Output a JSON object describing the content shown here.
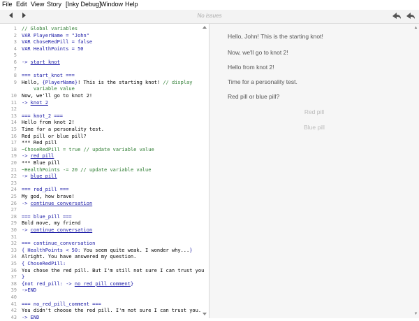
{
  "menu": [
    "File",
    "Edit",
    "View",
    "Story",
    "[Inky Debug]",
    "Window",
    "Help"
  ],
  "toolbar": {
    "back_icon": "left-triangle-icon",
    "forward_icon": "right-triangle-icon",
    "status": "No issues",
    "rewind_icon": "rewind-arrow-icon",
    "step_back_icon": "step-back-arrow-icon"
  },
  "code": [
    {
      "n": "1",
      "segs": [
        {
          "t": "// Global variables",
          "c": "cm"
        }
      ]
    },
    {
      "n": "2",
      "segs": [
        {
          "t": "VAR PlayerName = \"John\"",
          "c": "dv"
        }
      ]
    },
    {
      "n": "3",
      "segs": [
        {
          "t": "VAR ChoseRedPill = false",
          "c": "dv"
        }
      ]
    },
    {
      "n": "4",
      "segs": [
        {
          "t": "VAR HealthPoints = 50",
          "c": "dv"
        }
      ]
    },
    {
      "n": "5",
      "segs": []
    },
    {
      "n": "6",
      "segs": [
        {
          "t": "-> ",
          "c": "lg"
        },
        {
          "t": "start_knot",
          "c": "lk"
        }
      ]
    },
    {
      "n": "7",
      "segs": []
    },
    {
      "n": "8",
      "segs": [
        {
          "t": "=== start_knot ===",
          "c": "kn"
        }
      ]
    },
    {
      "n": "9",
      "segs": [
        {
          "t": "Hello, ",
          "c": ""
        },
        {
          "t": "{PlayerName}",
          "c": "lg"
        },
        {
          "t": "! This is the starting knot! ",
          "c": ""
        },
        {
          "t": "// display",
          "c": "cm"
        }
      ]
    },
    {
      "n": "",
      "segs": [
        {
          "t": "    variable value",
          "c": "cm"
        }
      ]
    },
    {
      "n": "10",
      "segs": [
        {
          "t": "Now, we'll go to knot 2!",
          "c": ""
        }
      ]
    },
    {
      "n": "11",
      "segs": [
        {
          "t": "-> ",
          "c": "lg"
        },
        {
          "t": "knot_2",
          "c": "lk"
        }
      ]
    },
    {
      "n": "12",
      "segs": []
    },
    {
      "n": "13",
      "segs": [
        {
          "t": "=== knot_2 ===",
          "c": "kn"
        }
      ]
    },
    {
      "n": "14",
      "segs": [
        {
          "t": "Hello from knot 2!",
          "c": ""
        }
      ]
    },
    {
      "n": "15",
      "segs": [
        {
          "t": "Time for a personality test.",
          "c": ""
        }
      ]
    },
    {
      "n": "16",
      "segs": [
        {
          "t": "Red pill or blue pill?",
          "c": ""
        }
      ]
    },
    {
      "n": "17",
      "segs": [
        {
          "t": "*** Red pill",
          "c": ""
        }
      ]
    },
    {
      "n": "18",
      "segs": [
        {
          "t": "~ChoseRedPill = true ",
          "c": "cm"
        },
        {
          "t": "// update variable value",
          "c": "cm"
        }
      ]
    },
    {
      "n": "19",
      "segs": [
        {
          "t": "-> ",
          "c": "lg"
        },
        {
          "t": "red_pill",
          "c": "lk"
        }
      ]
    },
    {
      "n": "20",
      "segs": [
        {
          "t": "*** Blue pill",
          "c": ""
        }
      ]
    },
    {
      "n": "21",
      "segs": [
        {
          "t": "~HealthPoints -= 20 ",
          "c": "cm"
        },
        {
          "t": "// update variable value",
          "c": "cm"
        }
      ]
    },
    {
      "n": "22",
      "segs": [
        {
          "t": "-> ",
          "c": "lg"
        },
        {
          "t": "blue_pill",
          "c": "lk"
        }
      ]
    },
    {
      "n": "23",
      "segs": []
    },
    {
      "n": "24",
      "segs": [
        {
          "t": "=== red_pill ===",
          "c": "kn"
        }
      ]
    },
    {
      "n": "25",
      "segs": [
        {
          "t": "My god, how brave!",
          "c": ""
        }
      ]
    },
    {
      "n": "26",
      "segs": [
        {
          "t": "-> ",
          "c": "lg"
        },
        {
          "t": "continue_conversation",
          "c": "lk"
        }
      ]
    },
    {
      "n": "27",
      "segs": []
    },
    {
      "n": "28",
      "segs": [
        {
          "t": "=== blue_pill ===",
          "c": "kn"
        }
      ]
    },
    {
      "n": "29",
      "segs": [
        {
          "t": "Bold move, my friend",
          "c": ""
        }
      ]
    },
    {
      "n": "30",
      "segs": [
        {
          "t": "-> ",
          "c": "lg"
        },
        {
          "t": "continue_conversation",
          "c": "lk"
        }
      ]
    },
    {
      "n": "31",
      "segs": []
    },
    {
      "n": "32",
      "segs": [
        {
          "t": "=== continue_conversation",
          "c": "kn"
        }
      ]
    },
    {
      "n": "33",
      "segs": [
        {
          "t": "{ HealthPoints < 50: ",
          "c": "lg"
        },
        {
          "t": "You seem quite weak. I wonder why...",
          "c": ""
        },
        {
          "t": "}",
          "c": "lg"
        }
      ]
    },
    {
      "n": "34",
      "segs": [
        {
          "t": "Alright. You have answered my question.",
          "c": ""
        }
      ]
    },
    {
      "n": "35",
      "segs": [
        {
          "t": "{ ChoseRedPill:",
          "c": "lg"
        }
      ]
    },
    {
      "n": "36",
      "segs": [
        {
          "t": "You chose the red pill. But I'm still not sure I can trust you",
          "c": ""
        }
      ]
    },
    {
      "n": "37",
      "segs": [
        {
          "t": "}",
          "c": "lg"
        }
      ]
    },
    {
      "n": "38",
      "segs": [
        {
          "t": "{not red_pill: -> ",
          "c": "lg"
        },
        {
          "t": "no_red_pill_comment",
          "c": "lk"
        },
        {
          "t": "}",
          "c": "lg"
        }
      ]
    },
    {
      "n": "39",
      "segs": [
        {
          "t": "->END",
          "c": "lg"
        }
      ]
    },
    {
      "n": "40",
      "segs": []
    },
    {
      "n": "41",
      "segs": [
        {
          "t": "=== no_red_pill_comment ===",
          "c": "kn"
        }
      ]
    },
    {
      "n": "42",
      "segs": [
        {
          "t": "You didn't choose the red pill. I'm not sure I can trust you.",
          "c": ""
        }
      ]
    },
    {
      "n": "43",
      "segs": [
        {
          "t": "-> END",
          "c": "lg"
        }
      ]
    }
  ],
  "preview": {
    "paragraphs": [
      "Hello, John! This is the starting knot!",
      "Now, we'll go to knot 2!",
      "Hello from knot 2!",
      "Time for a personality test.",
      "Red pill or blue pill?"
    ],
    "choices": [
      "Red pill",
      "Blue pill"
    ]
  },
  "colors": {
    "keyword": "#1a1aa6",
    "comment": "#2e7d32",
    "toolbar_bg": "#f3f3f3",
    "preview_bg": "#f6f6f6"
  }
}
